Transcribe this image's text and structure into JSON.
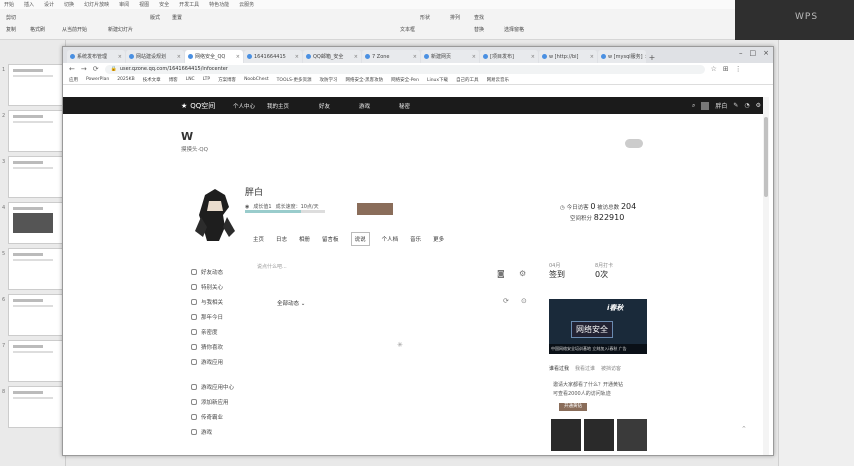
{
  "wps": {
    "menu": [
      "开始",
      "插入",
      "设计",
      "切换",
      "幻灯片放映",
      "审阅",
      "视图",
      "安全",
      "开发工具",
      "特色功能",
      "云服务"
    ],
    "ribbon": [
      "剪切",
      "复制",
      "格式刷",
      "从当前开始",
      "新建幻灯片",
      "版式",
      "重置",
      "文本框",
      "形状",
      "排列",
      "查找",
      "替换",
      "选择窗格"
    ],
    "logo_text": "WPS",
    "slide_numbers": [
      "1",
      "2",
      "3",
      "4",
      "5",
      "6",
      "7",
      "8",
      "9"
    ]
  },
  "browser": {
    "tabs": [
      {
        "label": "系统发布管理"
      },
      {
        "label": "网站建设规划"
      },
      {
        "label": "网络安全_QQ"
      },
      {
        "label": "1641664415"
      },
      {
        "label": "QQ邮箱_安全"
      },
      {
        "label": "7 Zone"
      },
      {
        "label": "新建网页"
      },
      {
        "label": "[项目发布]"
      },
      {
        "label": "w [http://bi]"
      },
      {
        "label": "w [mysql服务]"
      }
    ],
    "url": "user.qzone.qq.com/1641664415/infocenter",
    "bookmarks": [
      "应用",
      "PowerPlan",
      "2025KB",
      "技术文章",
      "博客",
      "LNC",
      "LTP",
      "方案博客",
      "NoobChest",
      "TOOLS-更多资源",
      "攻防学习",
      "网络安全-黑客攻防",
      "网络安全-Pen",
      "Linux下载",
      "自己的工具",
      "网易云音乐"
    ]
  },
  "qzone": {
    "brand": "QQ空间",
    "nav": [
      "个人中心",
      "我的主页",
      "好友",
      "游戏",
      "秘密"
    ],
    "nav_user": "胖白",
    "username": "W",
    "subtitle": "摸摸头·QQ",
    "profile_name": "胖白",
    "level_text": "成长值1",
    "growth_text": "成长速度：10点/天",
    "level_button": "",
    "visits_today_label": "今日访客",
    "visits_today": "0",
    "visits_total_label": "被访总数",
    "visits_total": "204",
    "space_score_label": "空间积分",
    "space_score": "822910",
    "profile_tabs": [
      "主页",
      "日志",
      "相册",
      "留言板",
      "说说",
      "个人档",
      "音乐",
      "更多"
    ],
    "active_tab": "说说",
    "sidebar": [
      "好友动态",
      "特别关心",
      "与我相关",
      "那年今日",
      "亲密度",
      "猜你喜欢",
      "游戏应用",
      "游戏应用中心",
      "添加新应用",
      "传奇霸业",
      "游戏"
    ],
    "feed_placeholder": "说点什么吧...",
    "feed_label": "全部动态",
    "checkin_date": "04月",
    "checkin_label": "签到",
    "checkin_count_label": "8月打卡",
    "checkin_count": "0次",
    "banner_title": "网络安全",
    "banner_logo": "i春秋",
    "banner_caption": "中国网络安全培训基地 立刻加入i春秋",
    "banner_ad": "广告",
    "visitor_tabs": [
      "谁看过我",
      "我看过谁",
      "被挡访客"
    ],
    "visitor_text_1": "邀请大家都看了什么？开通黄钻",
    "visitor_text_2": "可查看2000人的访问轨迹",
    "visitor_button": "开通黄钻"
  }
}
